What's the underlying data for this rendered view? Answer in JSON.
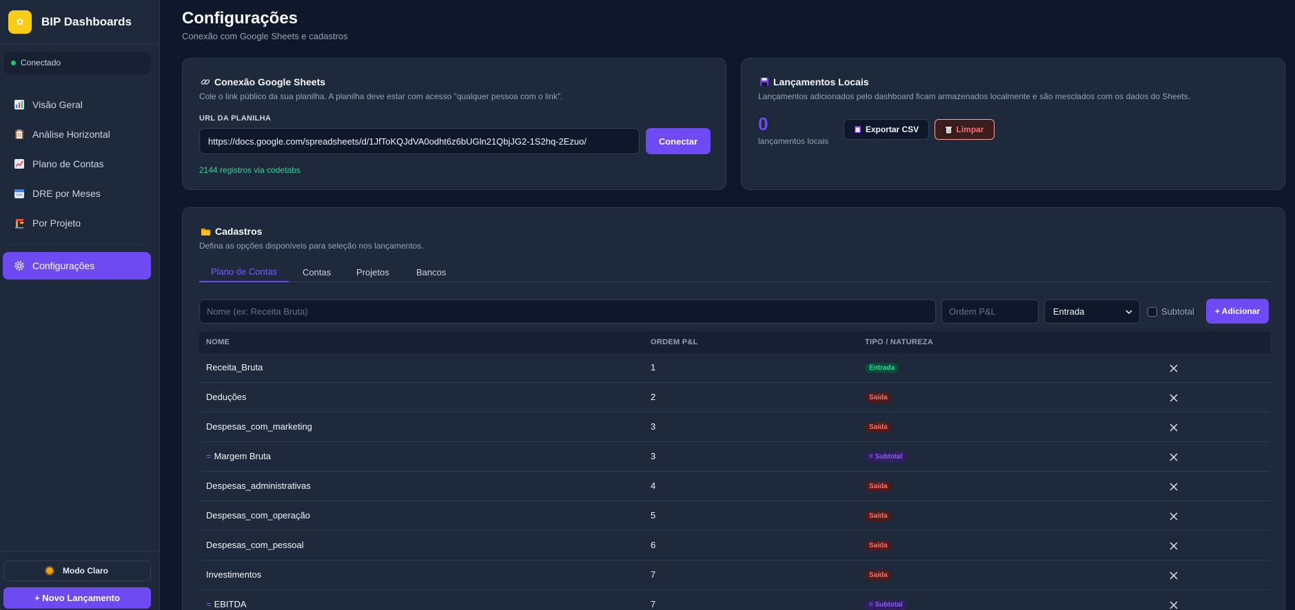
{
  "brand": {
    "logo": "✿",
    "name": "BIP Dashboards"
  },
  "status": {
    "text": "Conectado"
  },
  "nav": [
    {
      "label": "Visão Geral",
      "icon": "bar-chart-icon"
    },
    {
      "label": "Análise Horizontal",
      "icon": "clipboard-icon"
    },
    {
      "label": "Plano de Contas",
      "icon": "line-chart-icon"
    },
    {
      "label": "DRE por Meses",
      "icon": "calendar-icon"
    },
    {
      "label": "Por Projeto",
      "icon": "building-icon"
    },
    {
      "label": "Configurações",
      "icon": "gear-icon",
      "active": true
    }
  ],
  "sidebar_footer": {
    "mode_label": "Modo Claro",
    "new_label": "+ Novo Lançamento"
  },
  "page": {
    "title": "Configurações",
    "subtitle": "Conexão com Google Sheets e cadastros"
  },
  "sheets": {
    "title": "Conexão Google Sheets",
    "subtitle": "Cole o link público da sua planilha. A planilha deve estar com acesso \"qualquer pessoa com o link\".",
    "url_label": "URL DA PLANILHA",
    "url_value": "https://docs.google.com/spreadsheets/d/1JfToKQJdVA0odht6z6bUGln21QbjJG2-1S2hq-2Ezuo/",
    "connect_label": "Conectar",
    "records": "2144 registros via codetabs"
  },
  "local": {
    "title": "Lançamentos Locais",
    "subtitle": "Lançamentos adicionados pelo dashboard ficam armazenados localmente e são mesclados com os dados do Sheets.",
    "count": "0",
    "count_label": "lançamentos locais",
    "export_label": "Exportar CSV",
    "clear_label": "Limpar"
  },
  "cadastros": {
    "title": "Cadastros",
    "subtitle": "Defina as opções disponíveis para seleção nos lançamentos.",
    "tabs": [
      "Plano de Contas",
      "Contas",
      "Projetos",
      "Bancos"
    ],
    "name_placeholder": "Nome (ex: Receita Bruta)",
    "order_placeholder": "Ordem P&L",
    "type_selected": "Entrada",
    "subtotal_label": "Subtotal",
    "add_label": "+ Adicionar",
    "headers": {
      "name": "NOME",
      "order": "ORDEM P&L",
      "type": "TIPO / NATUREZA"
    },
    "rows": [
      {
        "name": "Receita_Bruta",
        "order": "1",
        "type": "Entrada",
        "kind": "entrada"
      },
      {
        "name": "Deduções",
        "order": "2",
        "type": "Saída",
        "kind": "saida"
      },
      {
        "name": "Despesas_com_marketing",
        "order": "3",
        "type": "Saída",
        "kind": "saida"
      },
      {
        "name": "Margem Bruta",
        "order": "3",
        "type": "= Subtotal",
        "kind": "subtotal",
        "prefix": "="
      },
      {
        "name": "Despesas_administrativas",
        "order": "4",
        "type": "Saída",
        "kind": "saida"
      },
      {
        "name": "Despesas_com_operação",
        "order": "5",
        "type": "Saída",
        "kind": "saida"
      },
      {
        "name": "Despesas_com_pessoal",
        "order": "6",
        "type": "Saída",
        "kind": "saida"
      },
      {
        "name": "Investimentos",
        "order": "7",
        "type": "Saída",
        "kind": "saida"
      },
      {
        "name": "EBITDA",
        "order": "7",
        "type": "= Subtotal",
        "kind": "subtotal",
        "prefix": "="
      }
    ]
  },
  "colors": {
    "accent": "#6d4af1",
    "success": "#22c55e",
    "danger": "#f87171"
  }
}
